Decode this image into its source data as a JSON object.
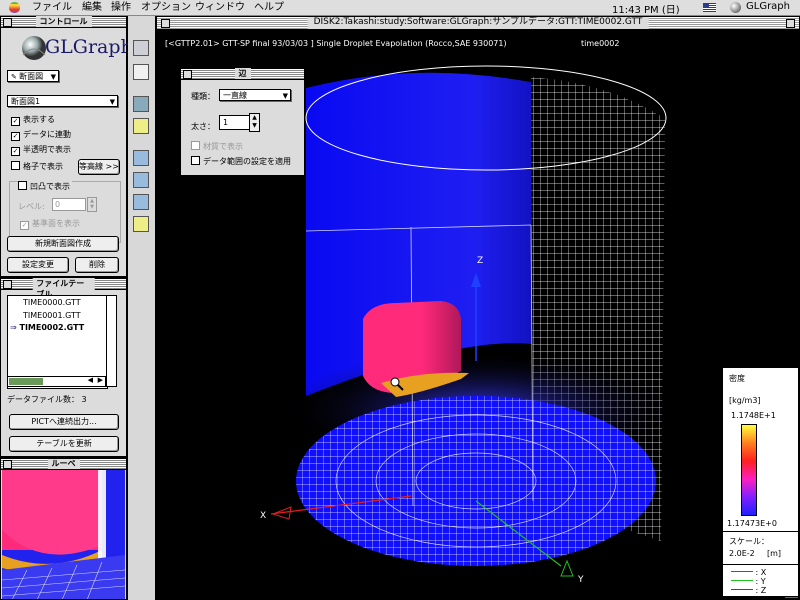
{
  "menubar": {
    "items": [
      "ファイル",
      "編集",
      "操作",
      "オプション",
      "ウィンドウ",
      "ヘルプ"
    ],
    "clock": "11:43 PM (日)",
    "app_name": "GLGraph"
  },
  "control": {
    "title": "コントロール",
    "logo": "GLGraph",
    "view_popup": "断面図",
    "section_popup": "断面図1",
    "checks": [
      {
        "label": "表示する",
        "checked": true
      },
      {
        "label": "データに連動",
        "checked": true
      },
      {
        "label": "半透明で表示",
        "checked": true
      },
      {
        "label": "格子で表示",
        "checked": false
      }
    ],
    "contour_button": "等高線 >>",
    "bump_check": "凹凸で表示",
    "level_label": "レベル:",
    "level_value": "0",
    "base_check": "基準面を表示",
    "new_section_button": "新規断面図作成",
    "apply_button": "設定変更",
    "delete_button": "削除"
  },
  "files": {
    "title": "ファイルテーブル",
    "items": [
      "TIME0000.GTT",
      "TIME0001.GTT",
      "TIME0002.GTT"
    ],
    "selected_index": 2,
    "count_label": "データファイル数：",
    "count_value": "3",
    "pict_button": "PICTへ連続出力...",
    "update_button": "テーブルを更新"
  },
  "loupe": {
    "title": "ルーペ"
  },
  "main": {
    "title": "DISK2:Takashi:study:Software:GLGraph:サンプルデータ:GTT:TIME0002.GTT",
    "info": "[<GTTP2.01> GTT-SP final 93/03/03 ] Single Droplet Evapolation (Rocco,SAE 930071)",
    "time_label": "time0002"
  },
  "edge_panel": {
    "title": "辺",
    "type_label": "種類：",
    "type_value": "一直線",
    "width_label": "太さ：",
    "width_value": "1",
    "texture_check": "材質で表示",
    "apply_range_check": "データ範囲の設定を適用"
  },
  "legend": {
    "quantity": "密度",
    "unit": "[kg/m3]",
    "max": "1.1748E+1",
    "min": "1.17473E+0",
    "scale_label": "スケール：",
    "scale_value": "2.0E-2",
    "scale_unit": "[m]",
    "axes": [
      {
        "label": ": X",
        "color": "#e02020"
      },
      {
        "label": ": Y",
        "color": "#20c020"
      },
      {
        "label": ": Z",
        "color": "#2040e0"
      }
    ]
  },
  "axis_labels": {
    "x": "X",
    "y": "Y",
    "z": "Z"
  },
  "colors": {
    "background": "#000000",
    "cylinder": "#1a1aff",
    "droplet": "#ff2a7a",
    "mesh": "#ffffff"
  }
}
